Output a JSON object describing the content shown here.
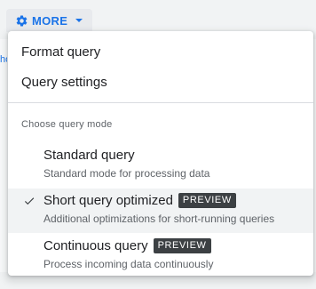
{
  "toolbar": {
    "more_label": "MORE",
    "more_icon": "gear-icon",
    "caret_icon": "chevron-down-icon",
    "accent_color": "#1a73e8"
  },
  "background": {
    "partial_link_text": "ho"
  },
  "menu": {
    "items": [
      {
        "label": "Format query"
      },
      {
        "label": "Query settings"
      }
    ],
    "section_title": "Choose query mode",
    "modes": [
      {
        "title": "Standard query",
        "description": "Standard mode for processing data",
        "selected": false,
        "badge": ""
      },
      {
        "title": "Short query optimized",
        "description": "Additional optimizations for short-running queries",
        "selected": true,
        "badge": "PREVIEW"
      },
      {
        "title": "Continuous query",
        "description": "Process incoming data continuously",
        "selected": false,
        "badge": "PREVIEW"
      }
    ],
    "selected_icon": "checkmark-icon",
    "badge_color": "#3c4043"
  }
}
